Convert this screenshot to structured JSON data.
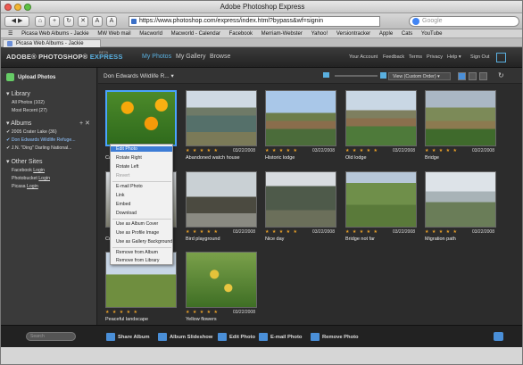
{
  "window_title": "Adobe Photoshop Express",
  "url": "https://www.photoshop.com/express/index.html?bypass&wf=signin",
  "browser_search_placeholder": "Google",
  "bookmarks": [
    "Picasa Web Albums - Jackie",
    "MW Web mail",
    "Macworld",
    "Macworld - Calendar",
    "Facebook",
    "Merriam-Webster",
    "Yahoo!",
    "Versiontracker",
    "Apple",
    "Cats",
    "YouTube"
  ],
  "tab_title": "Picasa Web Albums - Jackie",
  "app": {
    "logo_adobe": "ADOBE® PHOTOSHOP®",
    "logo_express": "EXPRESS",
    "logo_beta": "BETA",
    "nav": [
      "My Photos",
      "My Gallery",
      "Browse"
    ],
    "right_nav": [
      "Your Account",
      "Feedback",
      "Terms",
      "Privacy",
      "Help ▾",
      "Sign Out"
    ]
  },
  "sidebar": {
    "upload": "Upload Photos",
    "library_header": "Library",
    "library": [
      "All Photos (102)",
      "Most Recent (27)"
    ],
    "albums_header": "Albums",
    "albums": [
      "2005 Crater Lake (36)",
      "Don Edwards Wildlife Refuge...",
      "J.N. \"Ding\" Darling National..."
    ],
    "other_header": "Other Sites",
    "other_prefix": [
      "Facebook",
      "Photobucket",
      "Picasa"
    ],
    "login": "Login"
  },
  "content": {
    "album_title": "Don Edwards Wildlife R...",
    "view_select": "View (Custom Order)"
  },
  "photos": [
    {
      "caption": "Ca",
      "date": "03/22/2008",
      "stars": "★ ★ ★ ★ ★"
    },
    {
      "caption": "Abandoned watch house",
      "date": "03/22/2008",
      "stars": "★ ★ ★ ★ ★"
    },
    {
      "caption": "Historic lodge",
      "date": "03/22/2008",
      "stars": "★ ★ ★ ★ ★"
    },
    {
      "caption": "Old lodge",
      "date": "03/22/2008",
      "stars": "★ ★ ★ ★ ★"
    },
    {
      "caption": "Bridge",
      "date": "03/22/2008",
      "stars": "★ ★ ★ ★ ★"
    },
    {
      "caption": "Cr",
      "date": "",
      "stars": ""
    },
    {
      "caption": "Bird playground",
      "date": "03/22/2008",
      "stars": "★ ★ ★ ★ ★"
    },
    {
      "caption": "Nice day",
      "date": "03/22/2008",
      "stars": "★ ★ ★ ★ ★"
    },
    {
      "caption": "Bridge not far",
      "date": "03/22/2008",
      "stars": "★ ★ ★ ★ ★"
    },
    {
      "caption": "Migration path",
      "date": "03/22/2008",
      "stars": "★ ★ ★ ★ ★"
    },
    {
      "caption": "Peaceful landscape",
      "date": "",
      "stars": "★ ★ ★ ★ ★"
    },
    {
      "caption": "Yellow flowers",
      "date": "03/22/2008",
      "stars": "★ ★ ★ ★ ★"
    }
  ],
  "context_menu": [
    "Edit Photo",
    "Rotate Right",
    "Rotate Left",
    "Revert",
    "E-mail Photo",
    "Link",
    "Embed",
    "Download",
    "Use as Album Cover",
    "Use as Profile Image",
    "Use as Gallery Background",
    "Remove from Album",
    "Remove from Library"
  ],
  "bottom": {
    "search_placeholder": "Search",
    "buttons": [
      "Share Album",
      "Album Slideshow",
      "Edit Photo",
      "E-mail Photo",
      "Remove Photo"
    ]
  },
  "colors": {
    "accent": "#4aa3ff",
    "stars": "#e9a028",
    "menu_highlight": "#3c7cd6"
  }
}
